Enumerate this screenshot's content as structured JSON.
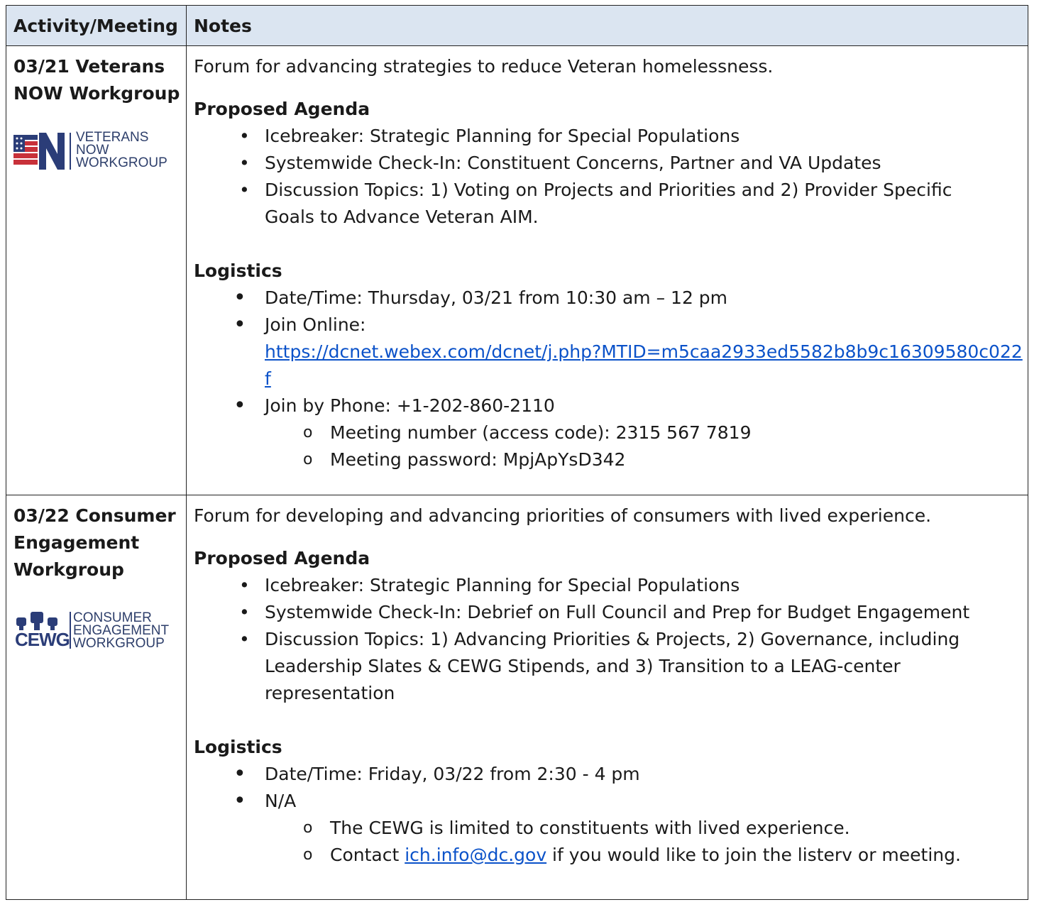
{
  "header": {
    "col1": "Activity/Meeting",
    "col2": "Notes"
  },
  "rows": [
    {
      "title": "03/21 Veterans NOW Workgroup",
      "logo_lines": [
        "VETERANS",
        "NOW",
        "WORKGROUP"
      ],
      "intro": "Forum for advancing strategies to reduce Veteran homelessness.",
      "agenda_heading": "Proposed Agenda",
      "agenda": [
        "Icebreaker: Strategic Planning for Special Populations",
        "Systemwide Check-In: Constituent Concerns, Partner and VA Updates",
        "Discussion Topics: 1) Voting on Projects and Priorities and 2) Provider Specific Goals to Advance Veteran AIM."
      ],
      "logistics_heading": "Logistics",
      "datetime": "Date/Time: Thursday, 03/21 from 10:30 am – 12 pm",
      "join_online_label": "Join Online:",
      "join_link": "https://dcnet.webex.com/dcnet/j.php?MTID=m5caa2933ed5582b8b9c16309580c022f",
      "join_phone": "Join by Phone: +1-202-860-2110",
      "meeting_number": "Meeting number (access code): 2315 567 7819",
      "meeting_password": "Meeting password: MpjApYsD342"
    },
    {
      "title": "03/22 Consumer Engagement Workgroup",
      "logo_lines": [
        "CONSUMER",
        "ENGAGEMENT",
        "WORKGROUP"
      ],
      "logo_mark": "CEWG",
      "intro": "Forum for developing and advancing priorities of consumers with lived experience.",
      "agenda_heading": "Proposed Agenda",
      "agenda": [
        "Icebreaker: Strategic Planning for Special Populations",
        "Systemwide Check-In: Debrief on Full Council and Prep for Budget Engagement",
        "Discussion Topics: 1) Advancing Priorities & Projects, 2) Governance, including Leadership Slates & CEWG Stipends, and 3) Transition to a LEAG-center representation"
      ],
      "logistics_heading": "Logistics",
      "datetime": "Date/Time: Friday, 03/22 from 2:30 - 4 pm",
      "na": "N/A",
      "limited": "The CEWG is limited to constituents with lived experience.",
      "contact_prefix": "Contact ",
      "contact_email": "ich.info@dc.gov",
      "contact_suffix": " if you would like to join the listerv or meeting."
    }
  ]
}
